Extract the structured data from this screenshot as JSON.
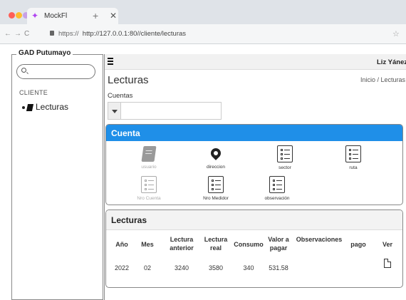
{
  "browser": {
    "tab_title": "MockFl",
    "tab_logo": "MockFl-logo-icon",
    "url_scheme": "https://",
    "url": "http://127.0.0.1:80//cliente/lecturas",
    "window_dots": [
      "#ff5f57",
      "#febc2e",
      "#c8a0e6"
    ]
  },
  "sidebar": {
    "title": "GAD Putumayo",
    "section": "CLIENTE",
    "items": [
      {
        "label": "Lecturas",
        "icon": "book-icon"
      }
    ]
  },
  "header": {
    "user": "Liz Yánez"
  },
  "page": {
    "title": "Lecturas",
    "breadcrumb": "Inicio / Lecturas",
    "cuentas_label": "Cuentas"
  },
  "cuenta_card": {
    "title": "Cuenta",
    "accent": "#1f8fe8",
    "tiles": [
      {
        "label": "usuario",
        "icon": "book-icon",
        "enabled": false
      },
      {
        "label": "direccion",
        "icon": "map-pin-icon",
        "enabled": true
      },
      {
        "label": "sector",
        "icon": "form-icon",
        "enabled": true
      },
      {
        "label": "ruta",
        "icon": "form-icon",
        "enabled": true
      },
      {
        "label": "Nro Cuenta",
        "icon": "form-icon",
        "enabled": false
      },
      {
        "label": "Nro Medidor",
        "icon": "form-icon",
        "enabled": true
      },
      {
        "label": "observación",
        "icon": "form-icon",
        "enabled": true
      }
    ]
  },
  "lecturas_card": {
    "title": "Lecturas",
    "columns": [
      "Año",
      "Mes",
      "Lectura anterior",
      "Lectura real",
      "Consumo",
      "Valor a pagar",
      "Observaciones",
      "pago",
      "Ver"
    ],
    "rows": [
      {
        "anio": "2022",
        "mes": "02",
        "lectura_anterior": "3240",
        "lectura_real": "3580",
        "consumo": "340",
        "valor": "531.58",
        "observaciones": "",
        "pago": "",
        "ver_icon": "document-icon"
      }
    ]
  }
}
